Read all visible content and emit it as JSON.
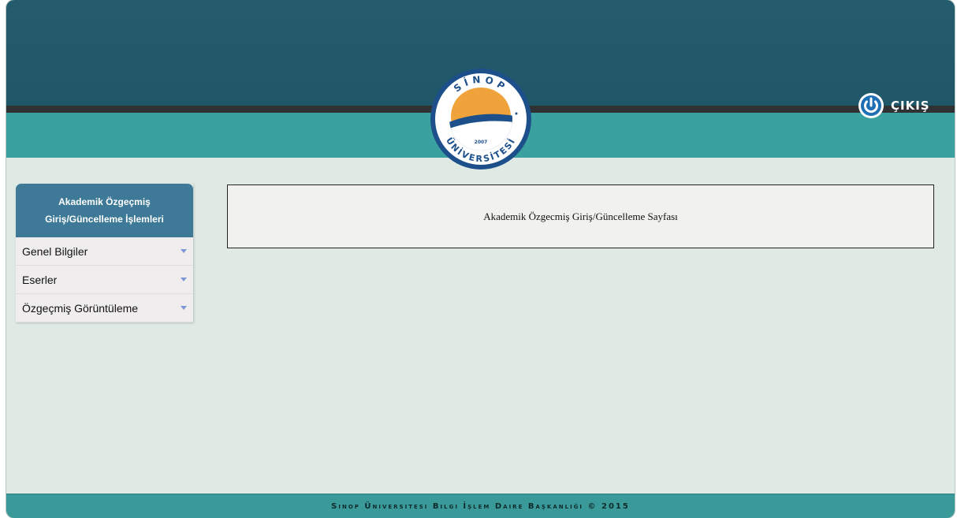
{
  "header": {
    "logo_top_text": "SİNOP",
    "logo_bottom_text": "ÜNİVERSİTESİ",
    "logo_year": "2007",
    "logout_label": "ÇIKIŞ"
  },
  "sidebar": {
    "title_line1": "Akademik Özgeçmiş",
    "title_line2": "Giriş/Güncelleme İşlemleri",
    "items": [
      {
        "label": "Genel Bilgiler"
      },
      {
        "label": "Eserler"
      },
      {
        "label": "Özgeçmiş Görüntüleme"
      }
    ]
  },
  "main": {
    "page_title": "Akademik Özgecmiş Giriş/Güncelleme Sayfası"
  },
  "footer": {
    "text": "Sinop Üniversitesi Bilgi İşlem Daire Başkanlığı © 2015"
  },
  "colors": {
    "header_dark": "#245c6e",
    "header_teal": "#3aa1a0",
    "sidebar_head": "#3e7a97",
    "page_bg": "#dfeae5"
  }
}
